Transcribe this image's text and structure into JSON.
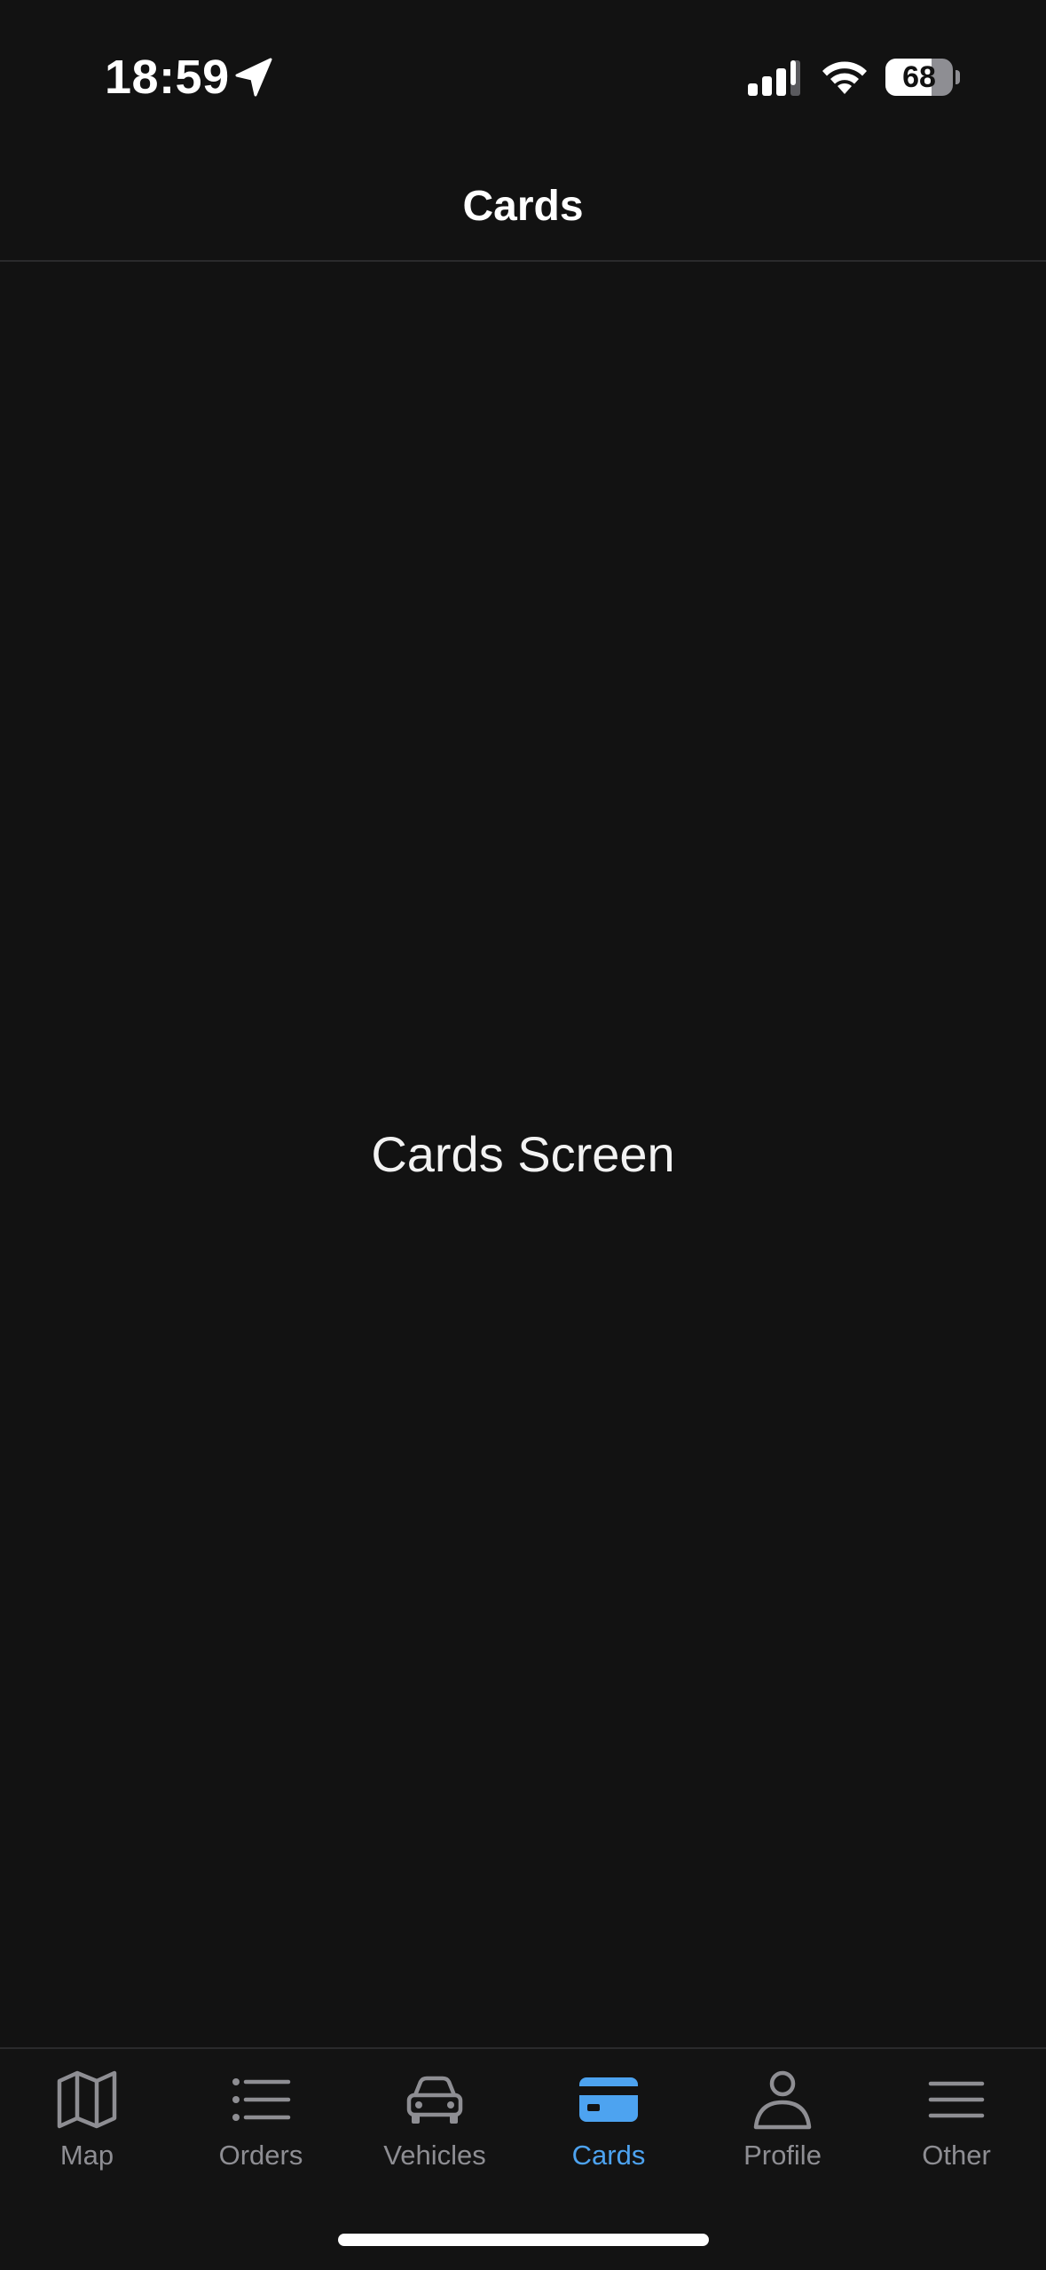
{
  "status_bar": {
    "time": "18:59",
    "battery_level": "68",
    "battery_fraction": 0.68,
    "icons": [
      "location-arrow-icon",
      "cellular-signal-icon",
      "wifi-icon",
      "battery-icon"
    ]
  },
  "header": {
    "title": "Cards"
  },
  "main": {
    "label": "Cards Screen"
  },
  "tab_bar": {
    "active_tab": "Cards",
    "active_color": "#4da3f0",
    "inactive_color": "#8e8e93",
    "tabs": [
      {
        "label": "Map",
        "icon": "map-icon"
      },
      {
        "label": "Orders",
        "icon": "list-icon"
      },
      {
        "label": "Vehicles",
        "icon": "car-icon"
      },
      {
        "label": "Cards",
        "icon": "credit-card-icon"
      },
      {
        "label": "Profile",
        "icon": "person-icon"
      },
      {
        "label": "Other",
        "icon": "menu-icon"
      }
    ]
  },
  "colors": {
    "background": "#121212",
    "divider": "#2a2a2c",
    "text": "#ffffff"
  }
}
